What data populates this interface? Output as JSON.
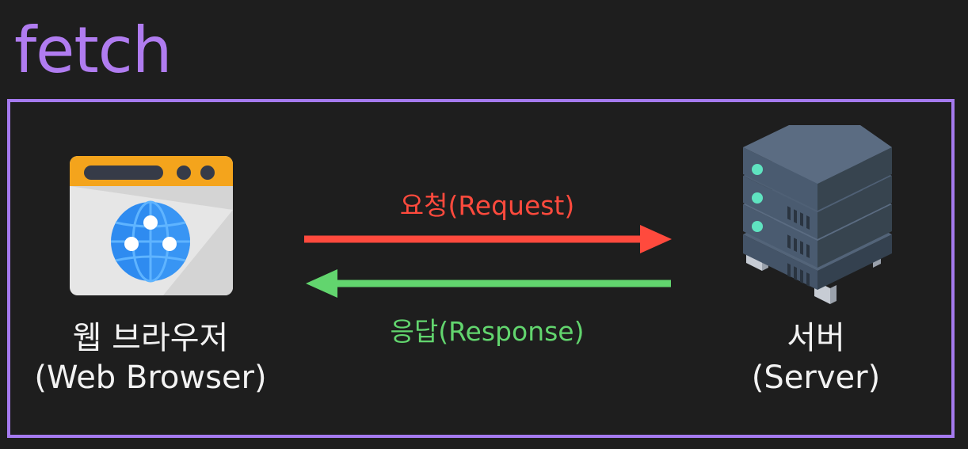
{
  "title": "fetch",
  "browser": {
    "icon": "web-browser-icon",
    "name_ko": "웹 브라우저",
    "name_en": "(Web Browser)"
  },
  "server": {
    "icon": "server-icon",
    "name_ko": "서버",
    "name_en": "(Server)"
  },
  "request": {
    "label": "요청(Request)",
    "color": "#ff4a3d"
  },
  "response": {
    "label": "응답(Response)",
    "color": "#62d56e"
  },
  "colors": {
    "background": "#1e1e1e",
    "accent": "#a57aef",
    "title": "#b07cf0"
  }
}
